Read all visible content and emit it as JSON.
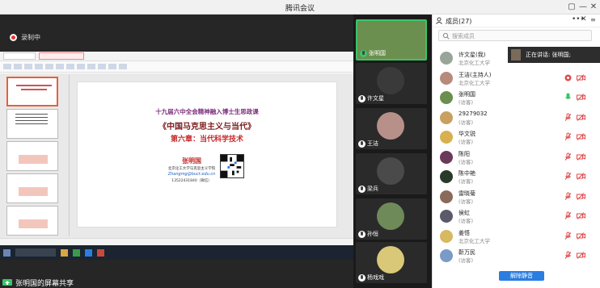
{
  "window": {
    "title": "腾讯会议",
    "controls": [
      "▢",
      "—",
      "✕"
    ]
  },
  "recording": {
    "label": "录制中"
  },
  "shared_screen": {
    "owner_label": "张明国的屏幕共享",
    "slide": {
      "line1": "十九届六中全会精神融入博士生思政课",
      "line2": "《中国马克思主义与当代》",
      "line3": "第六章：当代科学技术",
      "presenter": "张明国",
      "affiliation": "北京化工大学马克思主义学院",
      "email": "Zhangmg@buct.edu.cn",
      "phone": "13522431840（微信）"
    }
  },
  "videos": [
    {
      "name": "张明国",
      "mic": "on",
      "active": true,
      "color": "#6b8f4e"
    },
    {
      "name": "许文星",
      "mic": "off",
      "active": false,
      "color": "#3a3a3a"
    },
    {
      "name": "王洁",
      "mic": "off",
      "active": false,
      "color": "#b8908a"
    },
    {
      "name": "梁兵",
      "mic": "off",
      "active": false,
      "color": "#4a4a4a"
    },
    {
      "name": "孙恒",
      "mic": "off",
      "active": false,
      "color": "#6e8a58"
    },
    {
      "name": "杨戏戏",
      "mic": "off",
      "active": false,
      "color": "#d8c878"
    }
  ],
  "panel": {
    "title": "成员(27)",
    "more": "•••",
    "close": "✕",
    "search_placeholder": "搜索成员",
    "speaking_label": "正在讲话: 张明国;",
    "unmute_all": "解除静音",
    "members": [
      {
        "name": "许文星(我)",
        "sub": "北京化工大学",
        "color": "#9aa59a",
        "mic": "muted"
      },
      {
        "name": "王洁(主持人)",
        "sub": "北京化工大学",
        "color": "#b88a7a",
        "mic": "active-red"
      },
      {
        "name": "张明国",
        "sub": "(访客)",
        "color": "#6b8f4e",
        "mic": "speaking"
      },
      {
        "name": "29279032",
        "sub": "(访客)",
        "color": "#c8a060",
        "mic": "muted"
      },
      {
        "name": "华文锐",
        "sub": "(访客)",
        "color": "#d8b050",
        "mic": "muted"
      },
      {
        "name": "陈阳",
        "sub": "(访客)",
        "color": "#6a3a5a",
        "mic": "muted"
      },
      {
        "name": "陈中艳",
        "sub": "(访客)",
        "color": "#2a3a2a",
        "mic": "muted"
      },
      {
        "name": "雷晓菊",
        "sub": "(访客)",
        "color": "#8a6a5a",
        "mic": "muted"
      },
      {
        "name": "侯虹",
        "sub": "(访客)",
        "color": "#5a5a6a",
        "mic": "muted"
      },
      {
        "name": "姜悟",
        "sub": "北京化工大学",
        "color": "#d8b860",
        "mic": "muted"
      },
      {
        "name": "靳万民",
        "sub": "(访客)",
        "color": "#7a9ac8",
        "mic": "muted"
      }
    ]
  },
  "colors": {
    "accent": "#2a7de1",
    "active_border": "#3bc46a",
    "muted_red": "#e14b4b"
  }
}
